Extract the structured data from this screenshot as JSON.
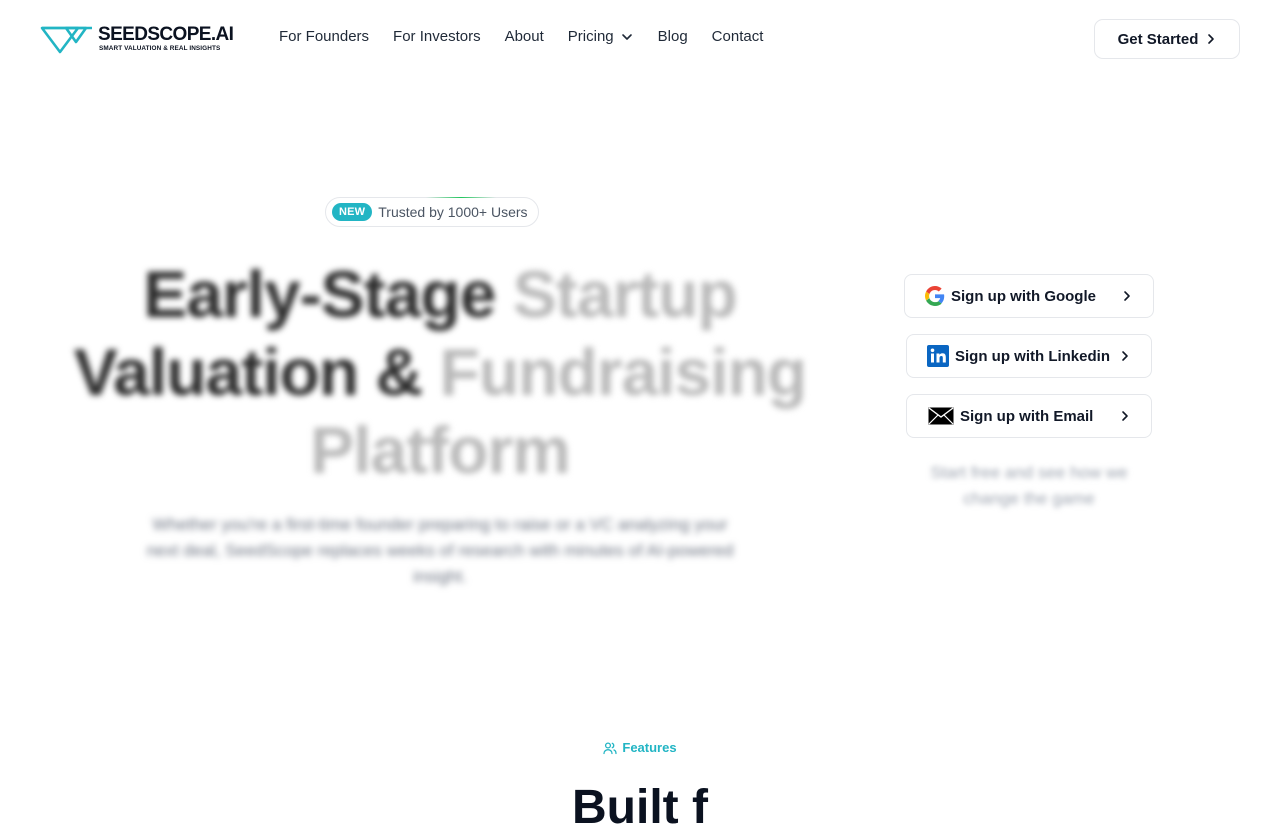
{
  "brand": {
    "name": "SEEDSCOPE.AI",
    "tagline": "SMART VALUATION & REAL INSIGHTS",
    "accent_color": "#22b5c4"
  },
  "nav": {
    "links": [
      {
        "label": "For Founders"
      },
      {
        "label": "For Investors"
      },
      {
        "label": "About"
      },
      {
        "label": "Pricing",
        "icon": "chevron-down-icon"
      },
      {
        "label": "Blog"
      },
      {
        "label": "Contact"
      }
    ],
    "cta_label": "Get Started"
  },
  "hero": {
    "badge_pill": "NEW",
    "badge_text": "Trusted by 1000+ Users",
    "title_parts": [
      "Early-Stage ",
      "Startup",
      "Valuation & ",
      "Fundraising",
      "Platform"
    ],
    "subtitle": "Whether you're a first-time founder preparing to raise or a VC analyzing your next deal, SeedScope replaces weeks of research with minutes of AI-powered insight."
  },
  "signup": {
    "google_label": "Sign up with Google",
    "linkedin_label": "Sign up with Linkedin",
    "email_label": "Sign up with Email",
    "note": "Start free and see how we change the game"
  },
  "features": {
    "label": "Features",
    "heading": "Built f"
  },
  "colors": {
    "google_blue": "#4285F4",
    "google_red": "#EA4335",
    "google_yellow": "#FBBC05",
    "google_green": "#34A853",
    "linkedin_blue": "#0A66C2"
  }
}
